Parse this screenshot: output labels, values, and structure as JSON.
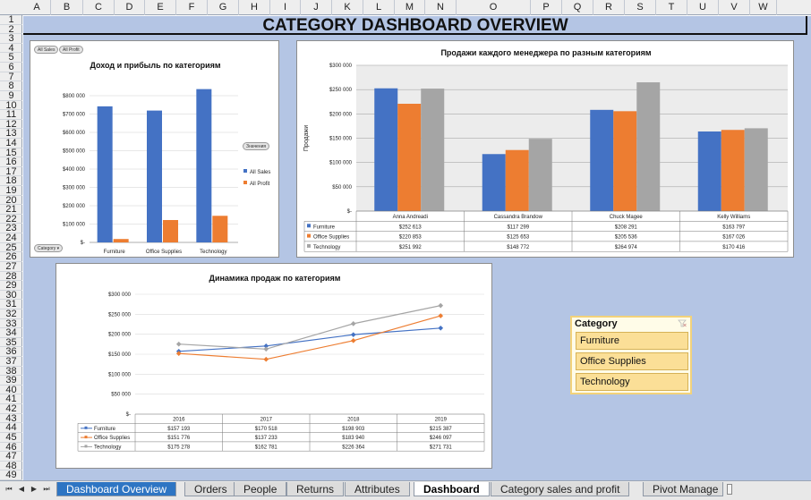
{
  "columns": [
    "A",
    "B",
    "C",
    "D",
    "E",
    "F",
    "G",
    "H",
    "I",
    "J",
    "K",
    "L",
    "M",
    "N",
    "O",
    "P",
    "Q",
    "R",
    "S",
    "T",
    "U",
    "V",
    "W"
  ],
  "rows": [
    "1",
    "2",
    "3",
    "4",
    "5",
    "6",
    "7",
    "8",
    "9",
    "10",
    "11",
    "12",
    "13",
    "14",
    "15",
    "16",
    "17",
    "18",
    "19",
    "20",
    "21",
    "22",
    "23",
    "24",
    "25",
    "26",
    "27",
    "28",
    "29",
    "30",
    "31",
    "32",
    "33",
    "34",
    "35",
    "36",
    "37",
    "38",
    "39",
    "40",
    "41",
    "42",
    "43",
    "44",
    "45",
    "46",
    "47",
    "48",
    "49"
  ],
  "title": "CATEGORY DASHBOARD OVERVIEW",
  "chart1": {
    "title": "Доход и прибыль  по категориям",
    "pill_sales": "All Sales",
    "pill_profit": "All Profit",
    "pill_values": "Значения",
    "pill_category": "Category",
    "legend": [
      "All Sales",
      "All Profit"
    ],
    "yticks": [
      "$800 000",
      "$700 000",
      "$600 000",
      "$500 000",
      "$400 000",
      "$300 000",
      "$200 000",
      "$100 000",
      "$-"
    ]
  },
  "chart2": {
    "title": "Продажи  каждого менеджера  по  разным  категориям",
    "ylabel": "Продажи",
    "yticks": [
      "$300 000",
      "$250 000",
      "$200 000",
      "$150 000",
      "$100 000",
      "$50 000",
      "$-"
    ],
    "table": [
      [
        "Furniture",
        "$252 613",
        "$117 299",
        "$208 291",
        "$163 797"
      ],
      [
        "Office Supplies",
        "$220 853",
        "$125 653",
        "$205 536",
        "$167 026"
      ],
      [
        "Technology",
        "$251 992",
        "$148 772",
        "$264 974",
        "$170 416"
      ]
    ]
  },
  "chart3": {
    "title": "Динамика  продаж по категориям",
    "yticks": [
      "$300 000",
      "$250 000",
      "$200 000",
      "$150 000",
      "$100 000",
      "$50 000",
      "$-"
    ],
    "table": [
      [
        "Furniture",
        "$157 193",
        "$170 518",
        "$198 903",
        "$215 387"
      ],
      [
        "Office Supplies",
        "$151 776",
        "$137 233",
        "$183 940",
        "$246 097"
      ],
      [
        "Technology",
        "$175 278",
        "$162 781",
        "$226 364",
        "$271 731"
      ]
    ]
  },
  "chart_data": [
    {
      "type": "bar",
      "title": "Доход и прибыль  по категориям",
      "categories": [
        "Furniture",
        "Office Supplies",
        "Technology"
      ],
      "series": [
        {
          "name": "All Sales",
          "values": [
            742000,
            719000,
            836000
          ],
          "color": "#4472c4"
        },
        {
          "name": "All Profit",
          "values": [
            18500,
            122000,
            145000
          ],
          "color": "#ed7d31"
        }
      ],
      "ylim": [
        0,
        800000
      ]
    },
    {
      "type": "bar",
      "title": "Продажи  каждого менеджера  по  разным  категориям",
      "ylabel": "Продажи",
      "categories": [
        "Anna Andreadi",
        "Cassandra Brandow",
        "Chuck Magee",
        "Kelly Williams"
      ],
      "series": [
        {
          "name": "Furniture",
          "values": [
            252613,
            117299,
            208291,
            163797
          ],
          "color": "#4472c4"
        },
        {
          "name": "Office Supplies",
          "values": [
            220853,
            125653,
            205536,
            167026
          ],
          "color": "#ed7d31"
        },
        {
          "name": "Technology",
          "values": [
            251992,
            148772,
            264974,
            170416
          ],
          "color": "#a5a5a5"
        }
      ],
      "ylim": [
        0,
        300000
      ]
    },
    {
      "type": "line",
      "title": "Динамика  продаж по категориям",
      "categories": [
        "2016",
        "2017",
        "2018",
        "2019"
      ],
      "series": [
        {
          "name": "Furniture",
          "values": [
            157193,
            170518,
            198903,
            215387
          ],
          "color": "#4472c4"
        },
        {
          "name": "Office Supplies",
          "values": [
            151776,
            137233,
            183940,
            246097
          ],
          "color": "#ed7d31"
        },
        {
          "name": "Technology",
          "values": [
            175278,
            162781,
            226364,
            271731
          ],
          "color": "#a5a5a5"
        }
      ],
      "ylim": [
        0,
        300000
      ]
    }
  ],
  "slicer": {
    "title": "Category",
    "clear_icon": "clear-filter-icon",
    "items": [
      "Furniture",
      "Office Supplies",
      "Technology"
    ]
  },
  "tabs": {
    "items": [
      "Dashboard Overview",
      "Orders",
      "People",
      "Returns",
      "Attributes",
      "Dashboard",
      "Category sales and profit",
      "Pivot Manage"
    ],
    "active": "Dashboard",
    "colors": {
      "blue": "#2e75c3",
      "active": "#ffffff"
    }
  },
  "colors": {
    "background": "#b4c5e4",
    "blue": "#4472c4",
    "orange": "#ed7d31",
    "gray": "#a5a5a5"
  }
}
